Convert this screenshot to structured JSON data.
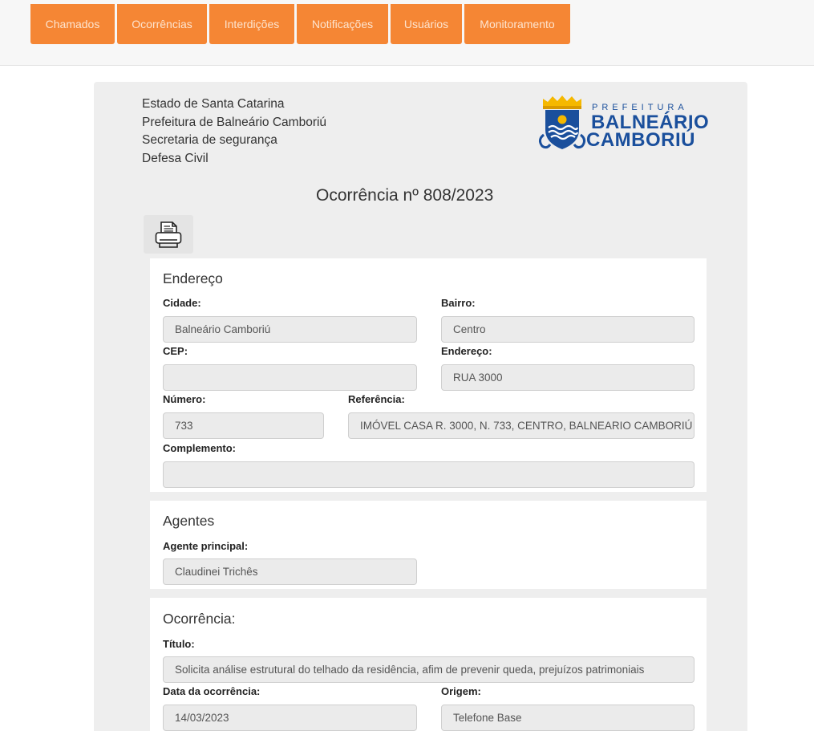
{
  "nav": {
    "tabs": [
      "Chamados",
      "Ocorrências",
      "Interdições",
      "Notificações",
      "Usuários",
      "Monitoramento"
    ]
  },
  "header": {
    "lines": [
      "Estado de Santa Catarina",
      "Prefeitura de Balneário Camboriú",
      "Secretaria de segurança",
      "Defesa Civil"
    ],
    "logo": {
      "line1": "PREFEITURA",
      "line2": "BALNEÁRIO",
      "line3": "CAMBORIÚ",
      "color": "#1a4f9c",
      "accent": "#f5b800"
    }
  },
  "page_title": "Ocorrência nº 808/2023",
  "print_icon": "printer-icon",
  "endereco": {
    "title": "Endereço",
    "cidade_label": "Cidade:",
    "cidade_value": "Balneário Camboriú",
    "bairro_label": "Bairro:",
    "bairro_value": "Centro",
    "cep_label": "CEP:",
    "cep_value": "",
    "endereco_label": "Endereço:",
    "endereco_value": "RUA 3000",
    "numero_label": "Número:",
    "numero_value": "733",
    "referencia_label": "Referência:",
    "referencia_value": "IMÓVEL CASA R. 3000, N. 733, CENTRO, BALNEARIO CAMBORIÚ",
    "complemento_label": "Complemento:",
    "complemento_value": ""
  },
  "agentes": {
    "title": "Agentes",
    "principal_label": "Agente principal:",
    "principal_value": "Claudinei Trichês"
  },
  "ocorrencia": {
    "title": "Ocorrência:",
    "titulo_label": "Título:",
    "titulo_value": "Solicita análise estrutural do telhado da residência, afim de prevenir queda, prejuízos patrimoniais",
    "data_label": "Data da ocorrência:",
    "data_value": "14/03/2023",
    "origem_label": "Origem:",
    "origem_value": "Telefone Base"
  },
  "colors": {
    "nav_bg": "#f58634",
    "nav_text": "#fde4cf",
    "card_bg": "#eeeeee",
    "field_bg": "#ebebeb"
  }
}
